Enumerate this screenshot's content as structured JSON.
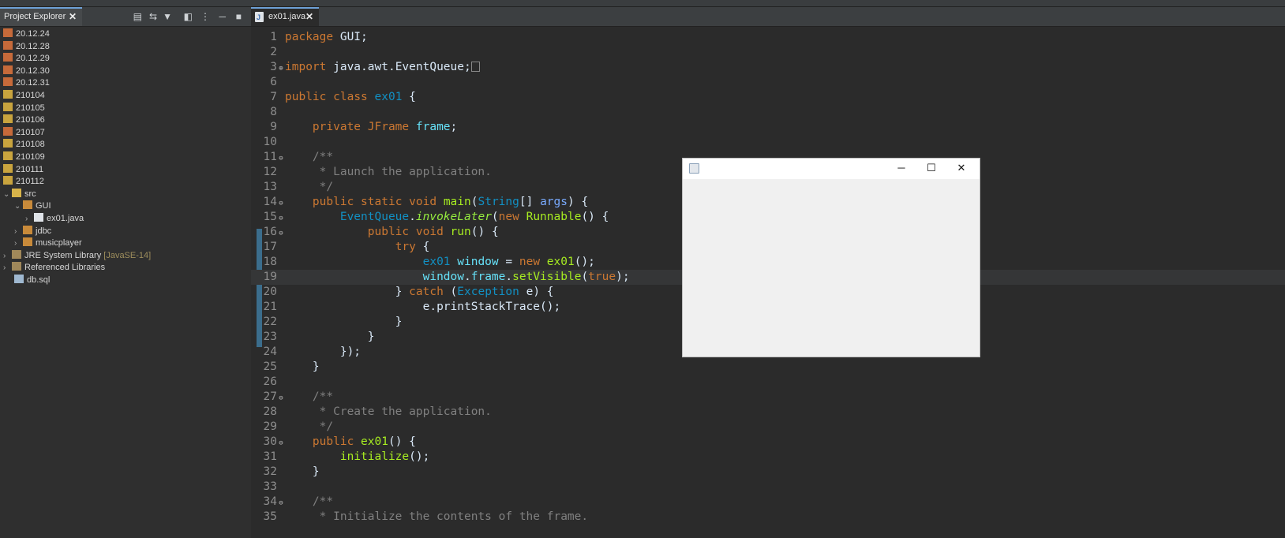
{
  "explorer": {
    "tab_label": "Project Explorer",
    "close_glyph": "✕",
    "items": [
      {
        "label": "20.12.24",
        "decoration": ""
      },
      {
        "label": "20.12.28",
        "decoration": ""
      },
      {
        "label": "20.12.29",
        "decoration": ""
      },
      {
        "label": "20.12.30",
        "decoration": ""
      },
      {
        "label": "20.12.31",
        "decoration": ""
      },
      {
        "label": "210104",
        "decoration": ""
      },
      {
        "label": "210105",
        "decoration": ""
      },
      {
        "label": "210106",
        "decoration": ""
      },
      {
        "label": "210107",
        "decoration": ""
      },
      {
        "label": "210108",
        "decoration": ""
      },
      {
        "label": "210109",
        "decoration": ""
      },
      {
        "label": "210111",
        "decoration": ""
      },
      {
        "label": "210112",
        "decoration": ""
      },
      {
        "label": "src",
        "decoration": ""
      },
      {
        "label": "GUI",
        "decoration": ""
      },
      {
        "label": "ex01.java",
        "decoration": ""
      },
      {
        "label": "jdbc",
        "decoration": ""
      },
      {
        "label": "musicplayer",
        "decoration": ""
      },
      {
        "label": "JRE System Library",
        "decoration": "[JavaSE-14]"
      },
      {
        "label": "Referenced Libraries",
        "decoration": ""
      },
      {
        "label": "db.sql",
        "decoration": ""
      }
    ]
  },
  "editor": {
    "tab_label": "ex01.java",
    "close_glyph": "✕",
    "lines": [
      {
        "n": "1",
        "mark": ""
      },
      {
        "n": "2",
        "mark": ""
      },
      {
        "n": "3",
        "mark": "⊕"
      },
      {
        "n": "6",
        "mark": ""
      },
      {
        "n": "7",
        "mark": ""
      },
      {
        "n": "8",
        "mark": ""
      },
      {
        "n": "9",
        "mark": ""
      },
      {
        "n": "10",
        "mark": ""
      },
      {
        "n": "11",
        "mark": "⊖"
      },
      {
        "n": "12",
        "mark": ""
      },
      {
        "n": "13",
        "mark": ""
      },
      {
        "n": "14",
        "mark": "⊖"
      },
      {
        "n": "15",
        "mark": "⊖"
      },
      {
        "n": "16",
        "mark": "⊖"
      },
      {
        "n": "17",
        "mark": ""
      },
      {
        "n": "18",
        "mark": ""
      },
      {
        "n": "19",
        "mark": ""
      },
      {
        "n": "20",
        "mark": ""
      },
      {
        "n": "21",
        "mark": ""
      },
      {
        "n": "22",
        "mark": ""
      },
      {
        "n": "23",
        "mark": ""
      },
      {
        "n": "24",
        "mark": ""
      },
      {
        "n": "25",
        "mark": ""
      },
      {
        "n": "26",
        "mark": ""
      },
      {
        "n": "27",
        "mark": "⊖"
      },
      {
        "n": "28",
        "mark": ""
      },
      {
        "n": "29",
        "mark": ""
      },
      {
        "n": "30",
        "mark": "⊖"
      },
      {
        "n": "31",
        "mark": ""
      },
      {
        "n": "32",
        "mark": ""
      },
      {
        "n": "33",
        "mark": ""
      },
      {
        "n": "34",
        "mark": "⊖"
      },
      {
        "n": "35",
        "mark": ""
      }
    ],
    "tokens": {
      "package": "package",
      "gui_pkg": " GUI;",
      "import": "import",
      "import_path": " java.awt.EventQueue;",
      "public": "public",
      "class": "class",
      "class_name": "ex01",
      "brace_open": " {",
      "private": "private",
      "jframe": "JFrame",
      "frame": "frame",
      "semicolon": ";",
      "doc_open": "/**",
      "doc_launch": " * Launch the application.",
      "doc_close": " */",
      "static": "static",
      "void": "void",
      "main": "main",
      "string": "String",
      "args": "args",
      "main_tail": "[] ",
      "paren_open": "(",
      "paren_close": ") {",
      "eventqueue": "EventQueue",
      "invoke_later": "invokeLater",
      "new": "new",
      "runnable": "Runnable",
      "runnable_tail": "() {",
      "run": "run",
      "run_tail": "() {",
      "try": "try",
      "try_tail": " {",
      "window": "window",
      "assign": " = ",
      "ctor_call": "ex01",
      "ctor_tail": "();",
      "set_visible": "setVisible",
      "true": "true",
      "set_visible_tail": ");",
      "catch": "catch",
      "exception": "Exception",
      "e": " e) {",
      "print": "e.printStackTrace();",
      "close_brace": "}",
      "close_run": "});",
      "doc_create": " * Create the application.",
      "ctor_decl_tail": "() {",
      "initialize": "initialize",
      "init_tail": "();",
      "doc_init": " * Initialize the contents of the frame."
    }
  },
  "swing_window": {
    "minimize_glyph": "─",
    "maximize_glyph": "☐",
    "close_glyph": "✕"
  },
  "colors": {
    "background": "#2b2b2b",
    "keyword": "#cc7832",
    "type": "#1290c3",
    "field": "#66e1f8",
    "method": "#a7ec21",
    "comment": "#808080"
  }
}
